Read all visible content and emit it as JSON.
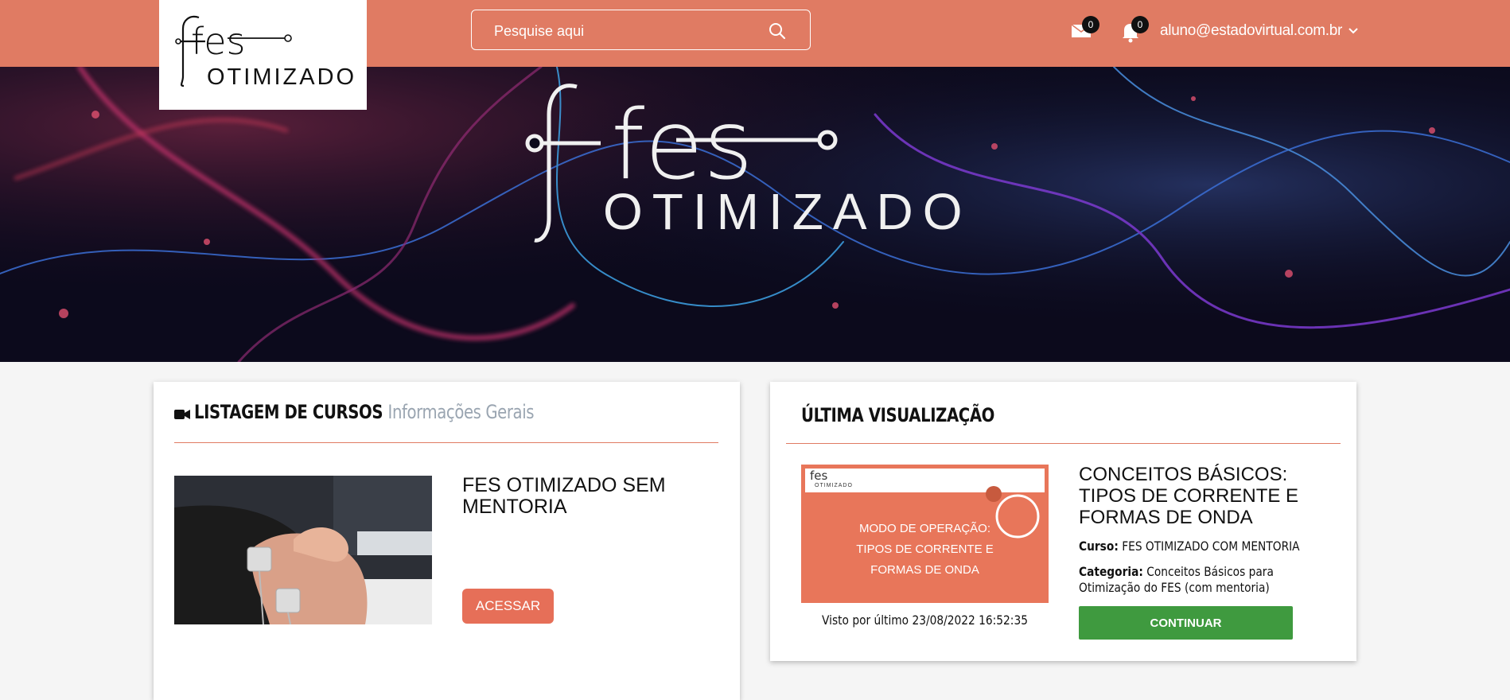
{
  "header": {
    "logo_top": "fes",
    "logo_bottom": "OTIMIZADO",
    "search_placeholder": "Pesquise aqui",
    "messages_count": "0",
    "notifications_count": "0",
    "user_email": "aluno@estadovirtual.com.br",
    "colors": {
      "bar": "#e07b63",
      "badge": "#111111"
    }
  },
  "hero": {
    "logo_top": "fes",
    "logo_bottom": "OTIMIZADO"
  },
  "courses_card": {
    "title": "LISTAGEM DE CURSOS",
    "subtitle": "Informações Gerais",
    "course": {
      "name": "FES OTIMIZADO SEM MENTORIA",
      "button": "ACESSAR"
    }
  },
  "last_view_card": {
    "title": "ÚLTIMA VISUALIZAÇÃO",
    "thumb_logo_top": "fes",
    "thumb_logo_bottom": "OTIMIZADO",
    "thumb_text": "MODO DE OPERAÇÃO:\nTIPOS DE CORRENTE E\nFORMAS DE ONDA",
    "lesson_title": "CONCEITOS BÁSICOS: TIPOS DE CORRENTE E FORMAS DE ONDA",
    "course_label": "Curso:",
    "course_value": "FES OTIMIZADO COM MENTORIA",
    "category_label": "Categoria:",
    "category_value": "Conceitos Básicos para Otimização do FES (com mentoria)",
    "seen_text": "Visto por último 23/08/2022 16:52:35",
    "button": "CONTINUAR",
    "colors": {
      "accent": "#e07b63",
      "continue": "#3f9a3f"
    }
  }
}
